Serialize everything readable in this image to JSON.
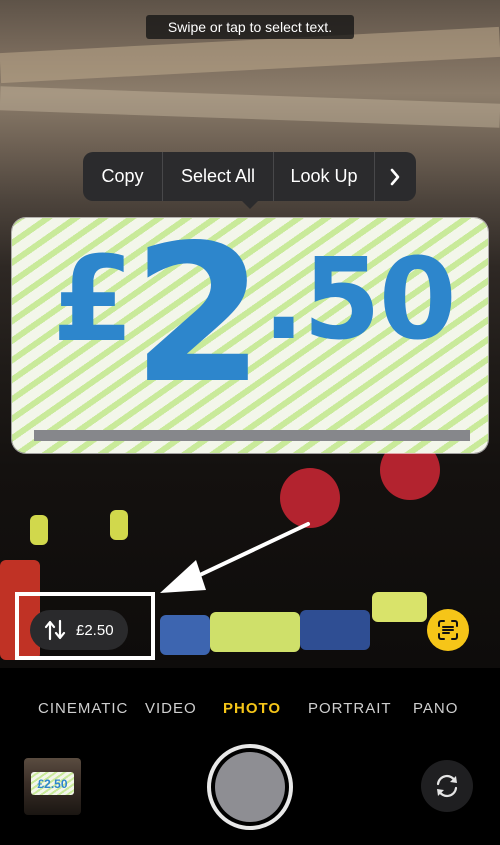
{
  "viewfinder": {
    "hint": "Swipe or tap to select text.",
    "context_menu": {
      "items": [
        "Copy",
        "Select All",
        "Look Up"
      ],
      "more_icon": "chevron-right-icon"
    },
    "price_card": {
      "pound": "£",
      "integer": "2",
      "decimal": ".50"
    },
    "detected_text": {
      "icon": "transform-arrows-icon",
      "label": "£2.50"
    },
    "scan_button_icon": "live-text-icon"
  },
  "modes": {
    "items": [
      "CINEMATIC",
      "VIDEO",
      "PHOTO",
      "PORTRAIT",
      "PANO"
    ],
    "active": "PHOTO"
  },
  "controls": {
    "thumbnail_text": "£2.50",
    "shutter_icon": "shutter-icon",
    "flip_icon": "flip-camera-icon"
  },
  "colors": {
    "accent": "#f5c518",
    "price_blue": "#2d86cc",
    "menu_bg": "#2b2b2d"
  }
}
